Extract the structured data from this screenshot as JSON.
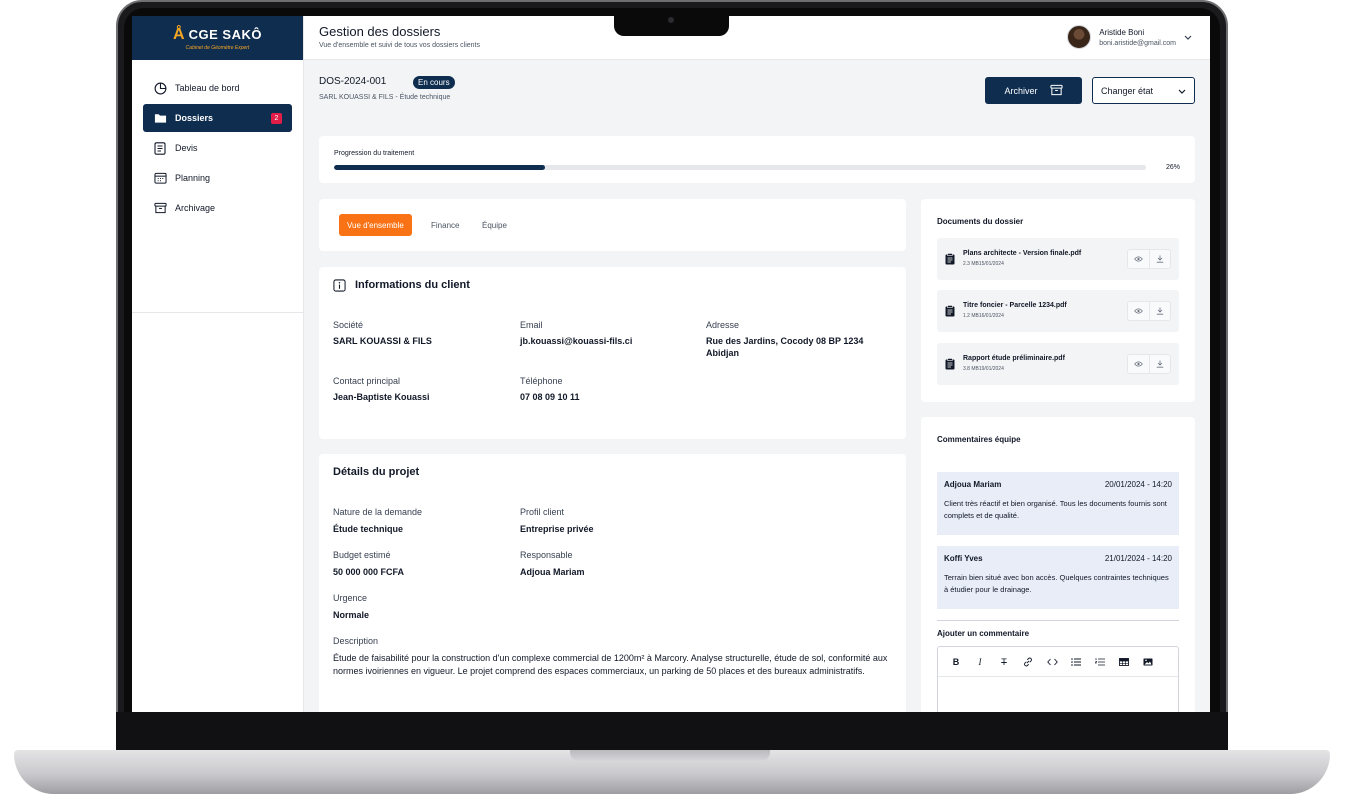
{
  "brand": {
    "name": "CGE SAKÔ",
    "tagline": "Cabinet de Géomètre Expert"
  },
  "sidebar": {
    "items": [
      {
        "label": "Tableau de bord",
        "icon": "dashboard-icon"
      },
      {
        "label": "Dossiers",
        "icon": "folder-icon",
        "badge": "2",
        "active": true
      },
      {
        "label": "Devis",
        "icon": "document-icon"
      },
      {
        "label": "Planning",
        "icon": "calendar-icon"
      },
      {
        "label": "Archivage",
        "icon": "archive-icon"
      }
    ]
  },
  "header": {
    "title": "Gestion des dossiers",
    "subtitle": "Vue d'ensemble et suivi de tous vos dossiers clients",
    "user": {
      "name": "Aristide Boni",
      "email": "boni.aristide@gmail.com"
    }
  },
  "dossier": {
    "id": "DOS-2024-001",
    "status": "En cours",
    "subtitle": "SARL KOUASSI & FILS - Étude technique",
    "archive_label": "Archiver",
    "state_label": "Changer état"
  },
  "progress": {
    "label": "Progression du traitement",
    "value_text": "26%",
    "fraction": 0.26
  },
  "tabs": [
    {
      "label": "Vue d'ensemble",
      "active": true
    },
    {
      "label": "Finance"
    },
    {
      "label": "Équipe"
    }
  ],
  "client": {
    "title": "Informations du client",
    "fields": {
      "societe": {
        "label": "Société",
        "value": "SARL KOUASSI & FILS"
      },
      "email": {
        "label": "Email",
        "value": "jb.kouassi@kouassi-fils.ci"
      },
      "adresse": {
        "label": "Adresse",
        "value": "Rue des Jardins, Cocody 08 BP 1234 Abidjan"
      },
      "contact": {
        "label": "Contact principal",
        "value": "Jean-Baptiste Kouassi"
      },
      "telephone": {
        "label": "Téléphone",
        "value": "07 08 09 10 11"
      }
    }
  },
  "project": {
    "title": "Détails du projet",
    "fields": {
      "nature": {
        "label": "Nature de la demande",
        "value": "Étude technique"
      },
      "profil": {
        "label": "Profil client",
        "value": "Entreprise privée"
      },
      "budget": {
        "label": "Budget estimé",
        "value": "50 000 000 FCFA"
      },
      "responsable": {
        "label": "Responsable",
        "value": "Adjoua Mariam"
      },
      "urgence": {
        "label": "Urgence",
        "value": "Normale"
      },
      "description": {
        "label": "Description",
        "value": "Étude de faisabilité pour la construction d'un complexe commercial de  1200m² à Marcory. Analyse structurelle, étude de sol, conformité aux  normes ivoiriennes en vigueur. Le projet comprend des espaces  commerciaux, un parking de 50 places et des bureaux administratifs."
      }
    }
  },
  "documents": {
    "title": "Documents du dossier",
    "items": [
      {
        "name": "Plans architecte - Version finale.pdf",
        "meta": "2.3 MB15/01/2024"
      },
      {
        "name": "Titre foncier - Parcelle 1234.pdf",
        "meta": "1.2 MB16/01/2024"
      },
      {
        "name": "Rapport étude préliminaire.pdf",
        "meta": "3.8 MB19/01/2024"
      }
    ]
  },
  "comments": {
    "title": "Commentaires équipe",
    "items": [
      {
        "author": "Adjoua Mariam",
        "date": "20/01/2024 - 14:20",
        "text": "Client très réactif et bien organisé. Tous les documents fournis sont complets et de qualité."
      },
      {
        "author": "Koffi Yves",
        "date": "21/01/2024 - 14:20",
        "text": "Terrain bien situé avec bon accès. Quelques contraintes techniques à étudier pour le drainage."
      }
    ],
    "add_label": "Ajouter un commentaire",
    "toolbar": [
      "B",
      "I",
      "T"
    ]
  },
  "colors": {
    "navy": "#0f2d4f",
    "orange": "#f97316",
    "badge_red": "#e11d48"
  }
}
